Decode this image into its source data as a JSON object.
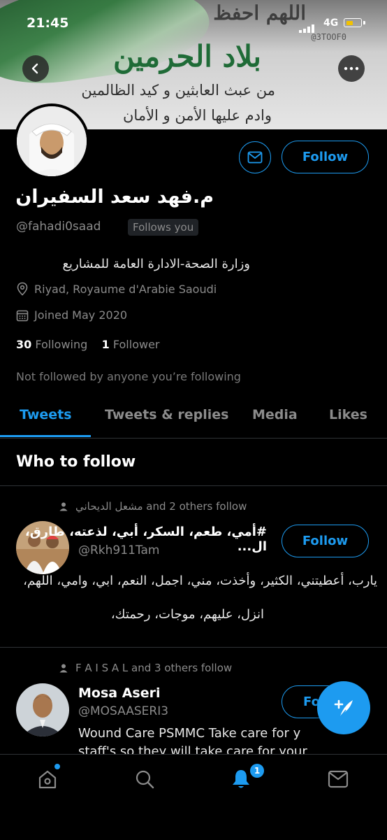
{
  "status_bar": {
    "time": "21:45",
    "network": "4G"
  },
  "banner": {
    "line1": "اللهم احفظ",
    "handle": "@3TOOF0",
    "line2": "بلاد الحرمين",
    "line3": "من عبث العابثين و كيد الظالمين",
    "line4": "وادم عليها الأمن و الأمان"
  },
  "profile": {
    "name": "م.فهد سعد السفيران",
    "handle": "@fahadi0saad",
    "follows_you": "Follows you",
    "bio": "وزارة الصحة-الادارة العامة للمشاريع",
    "location": "Riyad, Royaume d'Arabie Saoudi",
    "joined": "Joined May 2020",
    "following_count": "30",
    "following_label": "Following",
    "followers_count": "1",
    "followers_label": "Follower",
    "not_followed": "Not followed by anyone you’re following",
    "follow_label": "Follow"
  },
  "tabs": [
    {
      "label": "Tweets",
      "active": true
    },
    {
      "label": "Tweets & replies",
      "active": false
    },
    {
      "label": "Media",
      "active": false
    },
    {
      "label": "Likes",
      "active": false
    }
  ],
  "who_to_follow": {
    "title": "Who to follow",
    "suggestions": [
      {
        "social_context": "مشعل الديحاني and 2 others follow",
        "display_name": "#أمي، طعم، السكر، أبي، لذعته، طارق، ال...",
        "handle": "@Rkh911Tam",
        "bio_line1": "يارب، أعطيتني، الكثير، وأخذت، مني، اجمل، النعم، ابي، وامي، اللهم،",
        "bio_line2": "انزل، عليهم، موجات، رحمتك،",
        "follow_label": "Follow"
      },
      {
        "social_context": "F A I S A L and 3 others follow",
        "display_name": "Mosa Aseri",
        "handle": "@MOSAASERI3",
        "bio_line1": "Wound Care PSMMC Take care for y",
        "bio_line2": "staff's so they will take care for your",
        "follow_label": "Fo"
      }
    ]
  },
  "bottom_nav": {
    "notifications_badge": "1"
  },
  "colors": {
    "accent": "#1d9bf0",
    "background": "#000000",
    "secondary_text": "#8b8b8b"
  }
}
